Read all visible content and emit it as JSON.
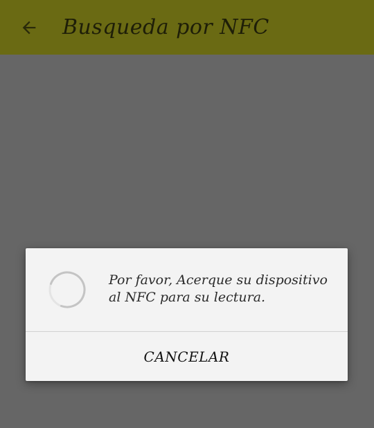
{
  "app_bar": {
    "title": "Busqueda por NFC",
    "back_icon": "arrow-left-icon",
    "background_color": "#6a6a13"
  },
  "dialog": {
    "spinner_icon": "progress-spinner-icon",
    "message_line1": "Por favor, Acerque su dispositivo",
    "message_line2": "al NFC para su lectura.",
    "cancel_label": "CANCELAR"
  }
}
